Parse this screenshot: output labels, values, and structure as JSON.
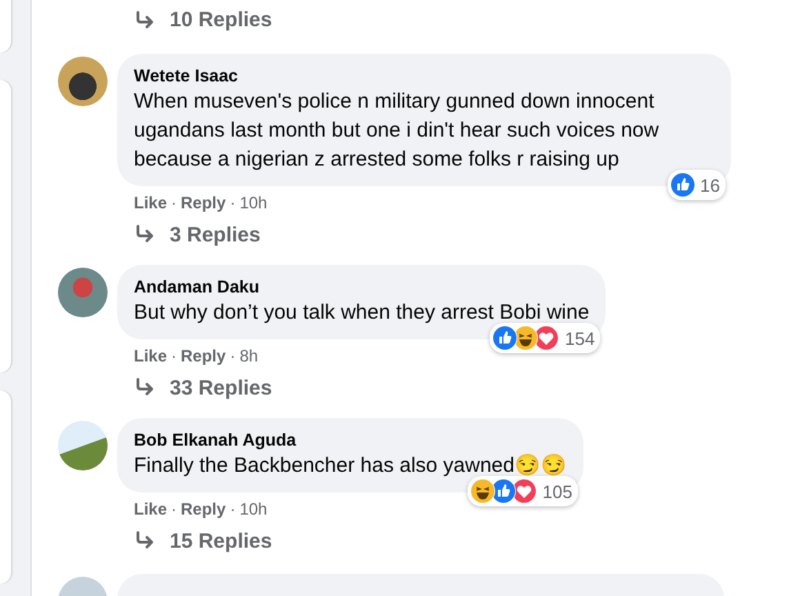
{
  "top_replies": {
    "label": "10 Replies"
  },
  "comments": [
    {
      "author": "Wetete Isaac",
      "text": "When museven's police n military gunned down innocent ugandans last month but one i din't hear such voices now because a nigerian z arrested some folks r raising up",
      "reactions": [
        {
          "kind": "like"
        }
      ],
      "reaction_count": "16",
      "actions": [
        "Like",
        "·",
        "Reply",
        "·"
      ],
      "time": "10h",
      "replies": "3 Replies"
    },
    {
      "author": "Andaman Daku",
      "text": "But why don’t you talk when they arrest Bobi wine",
      "reactions": [
        {
          "kind": "like"
        },
        {
          "kind": "haha"
        },
        {
          "kind": "love"
        }
      ],
      "reaction_count": "154",
      "actions": [
        "Like",
        "·",
        "Reply",
        "·"
      ],
      "time": "8h",
      "replies": "33 Replies"
    },
    {
      "author": "Bob Elkanah Aguda",
      "text": "Finally the Backbencher has also yawned😏😏",
      "reactions": [
        {
          "kind": "haha"
        },
        {
          "kind": "like"
        },
        {
          "kind": "love"
        }
      ],
      "reaction_count": "105",
      "actions": [
        "Like",
        "·",
        "Reply",
        "·"
      ],
      "time": "10h",
      "replies": "15 Replies"
    }
  ]
}
